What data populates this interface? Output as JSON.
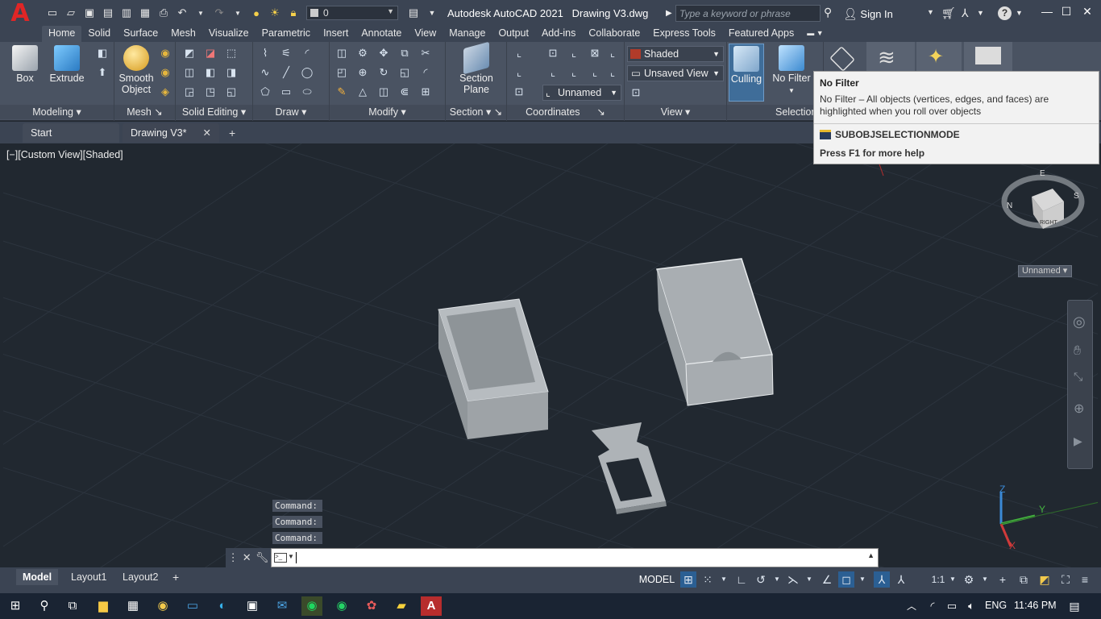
{
  "window": {
    "app_title": "Autodesk AutoCAD 2021",
    "file_title": "Drawing V3.dwg",
    "search_placeholder": "Type a keyword or phrase",
    "sign_in": "Sign In",
    "layer_value": "0"
  },
  "ribbon_tabs": [
    "Home",
    "Solid",
    "Surface",
    "Mesh",
    "Visualize",
    "Parametric",
    "Insert",
    "Annotate",
    "View",
    "Manage",
    "Output",
    "Add-ins",
    "Collaborate",
    "Express Tools",
    "Featured Apps"
  ],
  "ribbon": {
    "box": "Box",
    "extrude": "Extrude",
    "smooth_object": [
      "Smooth",
      "Object"
    ],
    "section_plane": [
      "Section",
      "Plane"
    ],
    "culling": "Culling",
    "no_filter": "No Filter",
    "panels": {
      "modeling": "Modeling",
      "mesh": "Mesh",
      "solid_editing": "Solid Editing",
      "draw": "Draw",
      "modify": "Modify",
      "section": "Section",
      "coordinates": "Coordinates",
      "view": "View",
      "selection": "Selection"
    },
    "visual_style": "Shaded",
    "named_view": "Unsaved View",
    "ucs_name": "Unnamed"
  },
  "tooltip": {
    "title": "No Filter",
    "description": "No Filter – All objects (vertices, edges, and faces) are highlighted when you roll over objects",
    "command": "SUBOBJSELECTIONMODE",
    "help": "Press F1 for more help"
  },
  "file_tabs": {
    "start": "Start",
    "drawing": "Drawing V3*"
  },
  "viewport": {
    "label": "[−][Custom View][Shaded]",
    "viewcube_face": "RIGHT",
    "viewcube_ucs": "Unnamed",
    "compass": {
      "n": "N",
      "e": "E",
      "s": "S"
    },
    "axes": {
      "x": "X",
      "y": "Y",
      "z": "Z"
    }
  },
  "command_history": [
    "Command:",
    "Command:",
    "Command:"
  ],
  "layout_tabs": [
    "Model",
    "Layout1",
    "Layout2"
  ],
  "status": {
    "model": "MODEL",
    "scale": "1:1"
  },
  "taskbar": {
    "lang": "ENG",
    "time": "11:46 PM"
  },
  "colors": {
    "accent": "#2b5f93",
    "background": "#212830",
    "ribbon": "#4a5362",
    "titlebar": "#3b4453"
  }
}
